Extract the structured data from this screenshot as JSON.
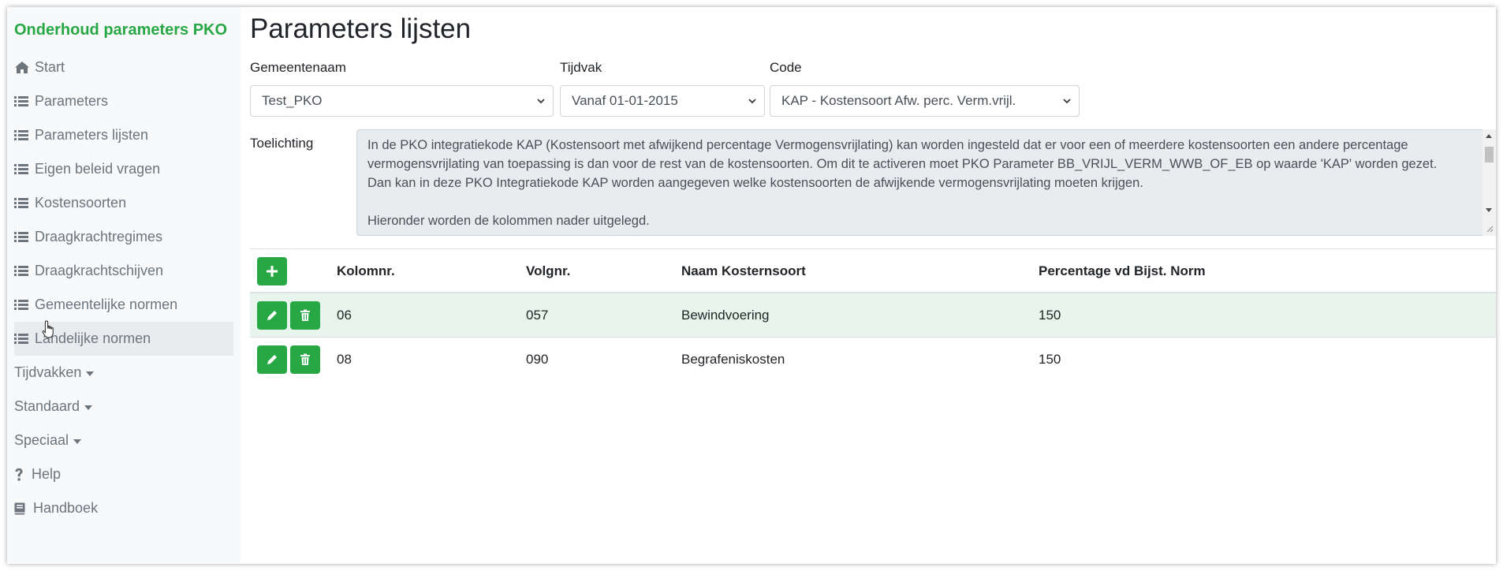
{
  "app": {
    "brand": "Onderhoud parameters PKO"
  },
  "sidebar": {
    "items": [
      {
        "label": "Start",
        "icon": "home-icon"
      },
      {
        "label": "Parameters",
        "icon": "list-icon"
      },
      {
        "label": "Parameters lijsten",
        "icon": "list-icon"
      },
      {
        "label": "Eigen beleid vragen",
        "icon": "list-icon"
      },
      {
        "label": "Kostensoorten",
        "icon": "list-icon"
      },
      {
        "label": "Draagkrachtregimes",
        "icon": "list-icon"
      },
      {
        "label": "Draagkrachtschijven",
        "icon": "list-icon"
      },
      {
        "label": "Gemeentelijke normen",
        "icon": "list-icon"
      },
      {
        "label": "Landelijke normen",
        "icon": "list-icon"
      },
      {
        "label": "Tijdvakken",
        "icon": "caret-down-icon"
      },
      {
        "label": "Standaard",
        "icon": "caret-down-icon"
      },
      {
        "label": "Speciaal",
        "icon": "caret-down-icon"
      },
      {
        "label": "Help",
        "icon": "question-icon"
      },
      {
        "label": "Handboek",
        "icon": "book-icon"
      }
    ]
  },
  "main": {
    "title": "Parameters lijsten",
    "filters": {
      "gemeente": {
        "label": "Gemeentenaam",
        "value": "Test_PKO"
      },
      "tijdvak": {
        "label": "Tijdvak",
        "value": "Vanaf 01-01-2015"
      },
      "code": {
        "label": "Code",
        "value": "KAP - Kostensoort Afw. perc. Verm.vrijl."
      }
    },
    "toelichting": {
      "label": "Toelichting",
      "lines": [
        "In de PKO integratiekode KAP (Kostensoort met afwijkend percentage Vermogensvrijlating) kan worden ingesteld dat er voor een of meerdere kostensoorten een andere percentage",
        "vermogensvrijlating van toepassing is dan voor de rest van de kostensoorten. Om dit te activeren moet PKO Parameter BB_VRIJL_VERM_WWB_OF_EB op waarde 'KAP' worden gezet.",
        "Dan kan in deze PKO Integratiekode KAP worden aangegeven welke kostensoorten de afwijkende vermogensvrijlating moeten krijgen.",
        "Hieronder worden de kolommen nader uitgelegd."
      ]
    },
    "table": {
      "headers": [
        "Kolomnr.",
        "Volgnr.",
        "Naam Kosternsoort",
        "Percentage vd Bijst. Norm"
      ],
      "rows": [
        [
          "06",
          "057",
          "Bewindvoering",
          "150"
        ],
        [
          "08",
          "090",
          "Begrafeniskosten",
          "150"
        ]
      ]
    }
  },
  "colors": {
    "brand": "#28a745",
    "sidebar_bg": "#f8f9fa",
    "row_highlight": "#e8f5ec"
  }
}
